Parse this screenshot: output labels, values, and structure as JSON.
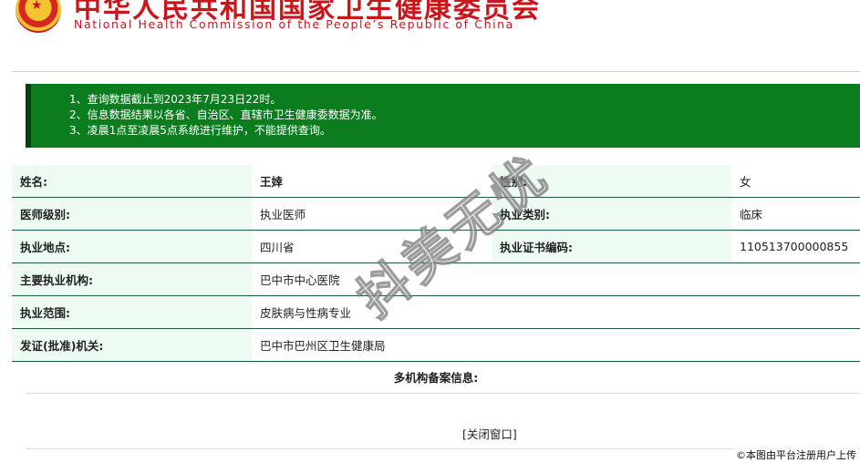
{
  "header": {
    "title_cn": "中华人民共和国国家卫生健康委员会",
    "title_en": "National Health Commission of the People’s Republic of China"
  },
  "notice": {
    "lines": [
      "1、查询数据截止到2023年7月23日22时。",
      "2、信息数据结果以各省、自治区、直辖市卫生健康委数据为准。",
      "3、凌晨1点至凌晨5点系统进行维护，不能提供查询。"
    ]
  },
  "info": {
    "name_label": "姓名:",
    "name_value": "王婞",
    "gender_label": "性别:",
    "gender_value": "女",
    "level_label": "医师级别:",
    "level_value": "执业医师",
    "category_label": "执业类别:",
    "category_value": "临床",
    "location_label": "执业地点:",
    "location_value": "四川省",
    "cert_label": "执业证书编码:",
    "cert_value": "110513700000855",
    "institution_label": "主要执业机构:",
    "institution_value": "巴中市中心医院",
    "scope_label": "执业范围:",
    "scope_value": "皮肤病与性病专业",
    "issuer_label": "发证(批准)机关:",
    "issuer_value": "巴中市巴州区卫生健康局"
  },
  "multi_institution_title": "多机构备案信息:",
  "close_button": "[关闭窗口]",
  "watermark": "抖美无忧",
  "credit": "©本图由平台注册用户上传",
  "colors": {
    "notice_bg": "#0b7d1f",
    "label_bg": "#edfbf2",
    "header_red": "#c8161d",
    "row_border": "#1e5a4a"
  }
}
